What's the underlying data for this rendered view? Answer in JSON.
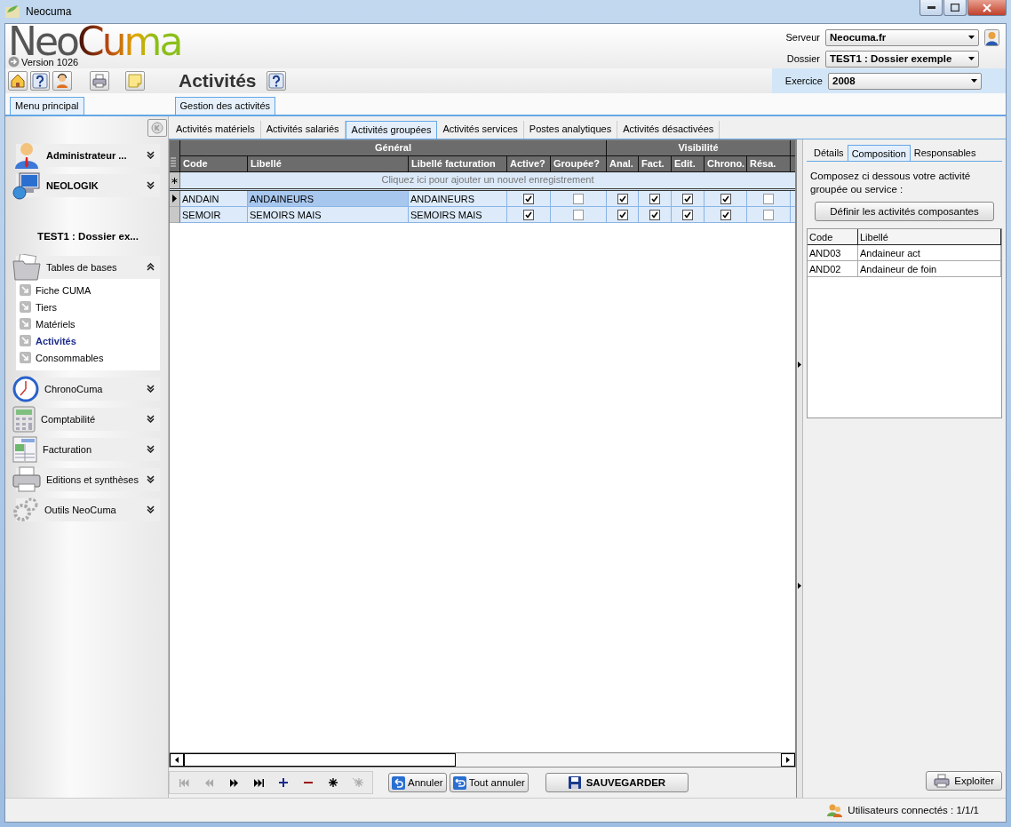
{
  "window": {
    "title": "Neocuma"
  },
  "header": {
    "logo": "NeoCuma",
    "version": "Version 1026",
    "selects": [
      {
        "label": "Serveur",
        "value": "Neocuma.fr"
      },
      {
        "label": "Dossier",
        "value": "TEST1 : Dossier exemple"
      }
    ],
    "year": {
      "label": "Exercice",
      "value": "2008"
    }
  },
  "page_title": "Activités",
  "sidebar": {
    "tab": "Menu principal",
    "accounts": [
      {
        "label": "Administrateur ..."
      },
      {
        "label": "NEOLOGIK"
      }
    ],
    "folder": "TEST1 : Dossier ex...",
    "modules": [
      {
        "label": "Tables de bases",
        "expanded": true,
        "items": [
          {
            "label": "Fiche CUMA",
            "selected": false
          },
          {
            "label": "Tiers",
            "selected": false
          },
          {
            "label": "Matériels",
            "selected": false
          },
          {
            "label": "Activités",
            "selected": true
          },
          {
            "label": "Consommables",
            "selected": false
          }
        ]
      },
      {
        "label": "ChronoCuma",
        "expanded": false
      },
      {
        "label": "Comptabilité",
        "expanded": false
      },
      {
        "label": "Facturation",
        "expanded": false
      },
      {
        "label": "Editions et synthèses",
        "expanded": false
      },
      {
        "label": "Outils NeoCuma",
        "expanded": false
      }
    ]
  },
  "main": {
    "tab": "Gestion des activités",
    "subtabs": [
      {
        "label": "Activités matériels",
        "selected": false
      },
      {
        "label": "Activités salariés",
        "selected": false
      },
      {
        "label": "Activités groupées",
        "selected": true
      },
      {
        "label": "Activités services",
        "selected": false
      },
      {
        "label": "Postes analytiques",
        "selected": false
      },
      {
        "label": "Activités désactivées",
        "selected": false
      }
    ],
    "grid": {
      "column_groups": [
        {
          "label": "Général",
          "columns": [
            {
              "label": "Code",
              "kind": "text"
            },
            {
              "label": "Libellé",
              "kind": "text"
            },
            {
              "label": "Libellé facturation",
              "kind": "text"
            },
            {
              "label": "Active?",
              "kind": "check"
            },
            {
              "label": "Groupée?",
              "kind": "check"
            }
          ]
        },
        {
          "label": "Visibilité",
          "columns": [
            {
              "label": "Anal.",
              "kind": "check"
            },
            {
              "label": "Fact.",
              "kind": "check"
            },
            {
              "label": "Edit.",
              "kind": "check"
            },
            {
              "label": "Chrono.",
              "kind": "check"
            },
            {
              "label": "Résa.",
              "kind": "check"
            }
          ]
        }
      ],
      "new_row_hint": "Cliquez ici pour ajouter un nouvel enregistrement",
      "rows": [
        {
          "selected": true,
          "values": [
            "ANDAIN",
            "ANDAINEURS",
            "ANDAINEURS",
            true,
            false,
            true,
            true,
            true,
            true,
            false
          ]
        },
        {
          "selected": false,
          "values": [
            "SEMOIR",
            "SEMOIRS MAIS",
            "SEMOIRS MAIS",
            true,
            false,
            true,
            true,
            true,
            true,
            false
          ]
        }
      ]
    },
    "nav_buttons": [
      {
        "kind": "first",
        "disabled": true
      },
      {
        "kind": "previous",
        "disabled": true
      },
      {
        "kind": "next",
        "disabled": false
      },
      {
        "kind": "last",
        "disabled": false
      },
      {
        "kind": "add",
        "disabled": false
      },
      {
        "kind": "remove",
        "disabled": false
      },
      {
        "kind": "edit",
        "disabled": false
      },
      {
        "kind": "cancel-edit",
        "disabled": true
      }
    ],
    "buttons": [
      {
        "kind": "undo",
        "label": "Annuler"
      },
      {
        "kind": "undo-all",
        "label": "Tout annuler"
      }
    ],
    "save_button": "SAUVEGARDER",
    "detail": {
      "tabs": [
        {
          "label": "Détails",
          "selected": false
        },
        {
          "label": "Composition",
          "selected": true
        },
        {
          "label": "Responsables",
          "selected": false
        }
      ],
      "text": "Composez ci dessous votre activité groupée ou service :",
      "button": "Définir les activités composantes",
      "table": {
        "columns": [
          "Code",
          "Libellé"
        ],
        "rows": [
          [
            "AND03",
            "Andaineur act"
          ],
          [
            "AND02",
            "Andaineur de foin"
          ]
        ]
      },
      "export_button": "Exploiter"
    }
  },
  "status_bar": {
    "users": "Utilisateurs connectés : 1/1/1"
  }
}
